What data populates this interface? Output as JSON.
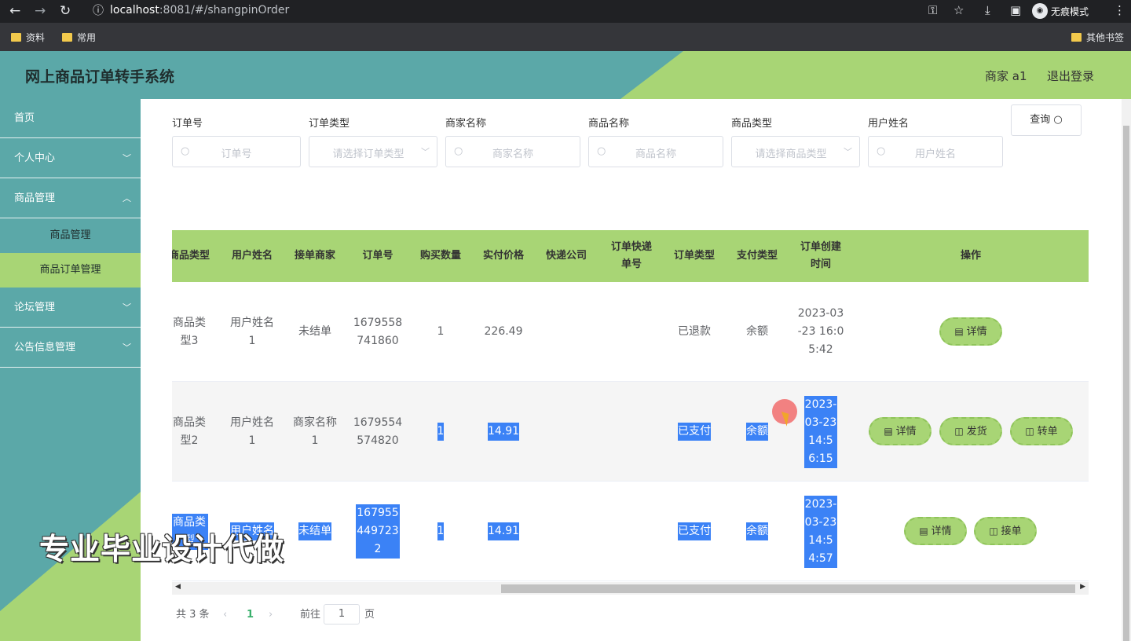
{
  "browser": {
    "url_host": "localhost",
    "url_rest": ":8081/#/shangpinOrder",
    "incognito_label": "无痕模式",
    "bookmarks": [
      "资料",
      "常用"
    ],
    "other_bookmarks": "其他书签"
  },
  "header": {
    "title": "网上商品订单转手系统",
    "user": "商家 a1",
    "logout": "退出登录"
  },
  "sidebar": {
    "items": [
      {
        "label": "首页"
      },
      {
        "label": "个人中心"
      },
      {
        "label": "商品管理"
      },
      {
        "label": "论坛管理"
      },
      {
        "label": "公告信息管理"
      }
    ],
    "subitems": [
      {
        "label": "商品管理"
      },
      {
        "label": "商品订单管理"
      }
    ]
  },
  "filters": [
    {
      "label": "订单号",
      "placeholder": "订单号",
      "type": "input"
    },
    {
      "label": "订单类型",
      "placeholder": "请选择订单类型",
      "type": "select"
    },
    {
      "label": "商家名称",
      "placeholder": "商家名称",
      "type": "input"
    },
    {
      "label": "商品名称",
      "placeholder": "商品名称",
      "type": "input"
    },
    {
      "label": "商品类型",
      "placeholder": "请选择商品类型",
      "type": "select"
    },
    {
      "label": "用户姓名",
      "placeholder": "用户姓名",
      "type": "input"
    }
  ],
  "query_button": "查询",
  "table": {
    "columns": [
      "商品类型",
      "用户姓名",
      "接单商家",
      "订单号",
      "购买数量",
      "实付价格",
      "快递公司",
      "订单快递单号",
      "订单类型",
      "支付类型",
      "订单创建时间",
      "操作"
    ],
    "rows": [
      {
        "product_type": "商品类型3",
        "user_name": "用户姓名1",
        "merchant": "未结单",
        "order_no": "1679558741860",
        "quantity": "1",
        "price": "226.49",
        "courier": "",
        "tracking_no": "",
        "order_type": "已退款",
        "pay_type": "余额",
        "created": "2023-03-23 16:05:42",
        "actions": [
          "详情"
        ]
      },
      {
        "product_type": "商品类型2",
        "user_name": "用户姓名1",
        "merchant": "商家名称1",
        "order_no": "1679554574820",
        "quantity": "1",
        "price": "14.91",
        "courier": "",
        "tracking_no": "",
        "order_type": "已支付",
        "pay_type": "余额",
        "created": "2023-03-23 14:56:15",
        "actions": [
          "详情",
          "发货",
          "转单"
        ]
      },
      {
        "product_type": "商品类型",
        "user_name": "用户姓名",
        "merchant": "未结单",
        "order_no": "1679554497232",
        "quantity": "1",
        "price": "14.91",
        "courier": "",
        "tracking_no": "",
        "order_type": "已支付",
        "pay_type": "余额",
        "created": "2023-03-23 14:54:57",
        "actions": [
          "详情",
          "接单"
        ]
      }
    ]
  },
  "pagination": {
    "total": "共 3 条",
    "current": "1",
    "goto_label": "前往",
    "goto_value": "1",
    "page_suffix": "页"
  },
  "watermark": "专业毕业设计代做",
  "colors": {
    "accent_green": "#a8d575",
    "teal": "#5ba8a8",
    "selection": "#3b82f6"
  }
}
